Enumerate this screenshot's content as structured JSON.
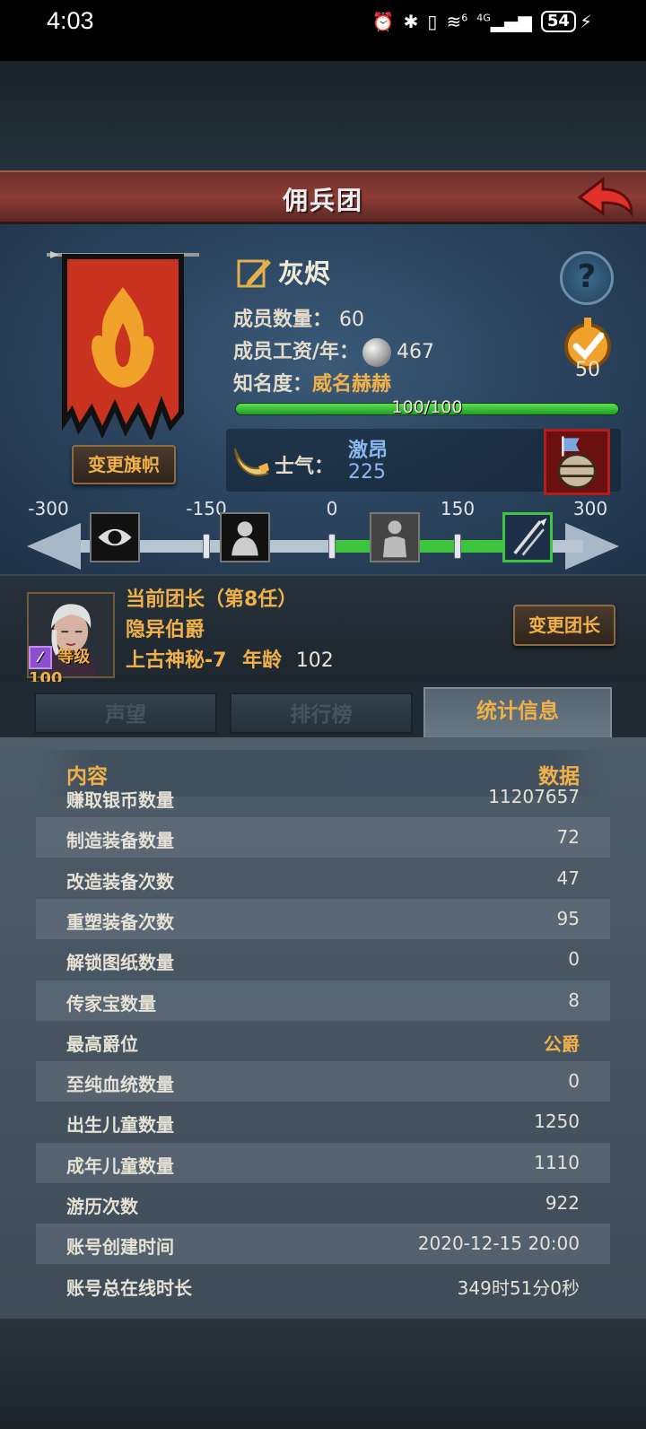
{
  "status_bar": {
    "time": "4:03",
    "icons": [
      "alarm-icon",
      "bluetooth-icon",
      "vibrate-icon",
      "wifi-icon",
      "signal-4g-icon"
    ],
    "wifi_label": "6",
    "network_label": "4G",
    "battery": "54"
  },
  "header": {
    "title": "佣兵团"
  },
  "guild": {
    "name": "灰烬",
    "members_label": "成员数量：",
    "members_value": "60",
    "wage_label": "成员工资/年：",
    "wage_value": "467",
    "fame_label": "知名度：",
    "fame_value": "威名赫赫",
    "fame_progress_text": "100/100",
    "fame_progress": 1.0,
    "medal_value": "50",
    "change_banner_button": "变更旗帜",
    "help_button": "?"
  },
  "morale": {
    "label": "士气：",
    "state": "激昂",
    "value": "225",
    "scale_ticks": [
      "-300",
      "-150",
      "0",
      "150",
      "300"
    ],
    "scale_min": -300,
    "scale_max": 300,
    "green_from": 0,
    "green_to": 225
  },
  "leader": {
    "title": "当前团长（第8任）",
    "name": "隐异伯爵",
    "level_text": "等级100",
    "class": "上古神秘-7",
    "age_label": "年龄",
    "age": "102",
    "change_button": "变更团长"
  },
  "tabs": [
    {
      "label": "声望",
      "active": false
    },
    {
      "label": "排行榜",
      "active": false
    },
    {
      "label": "统计信息",
      "active": true
    }
  ],
  "stats": {
    "header_content": "内容",
    "header_data": "数据",
    "rows": [
      {
        "k": "赚取银币数量",
        "v": "11207657"
      },
      {
        "k": "制造装备数量",
        "v": "72"
      },
      {
        "k": "改造装备次数",
        "v": "47"
      },
      {
        "k": "重塑装备次数",
        "v": "95"
      },
      {
        "k": "解锁图纸数量",
        "v": "0"
      },
      {
        "k": "传家宝数量",
        "v": "8"
      },
      {
        "k": "最高爵位",
        "v": "公爵"
      },
      {
        "k": "至纯血统数量",
        "v": "0"
      },
      {
        "k": "出生儿童数量",
        "v": "1250"
      },
      {
        "k": "成年儿童数量",
        "v": "1110"
      },
      {
        "k": "游历次数",
        "v": "922"
      },
      {
        "k": "账号创建时间",
        "v": "2020-12-15 20:00"
      },
      {
        "k": "账号总在线时长",
        "v": "349时51分0秒"
      }
    ]
  },
  "colors": {
    "accent_gold": "#f0b14a",
    "header_red": "#8d3c35",
    "bar_green": "#3fc43f"
  }
}
